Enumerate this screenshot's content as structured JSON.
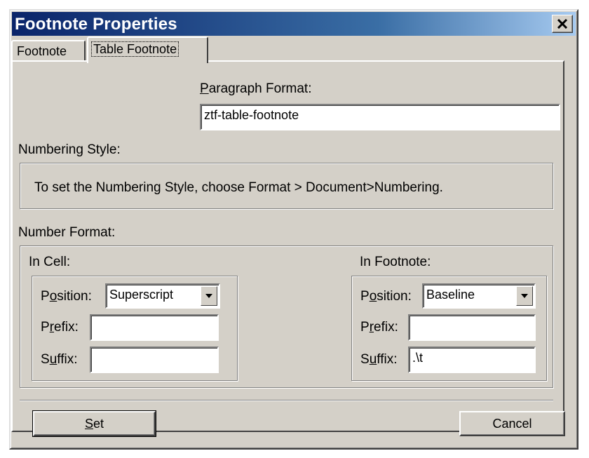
{
  "window": {
    "title": "Footnote Properties",
    "close_icon": "close-icon"
  },
  "tabs": [
    {
      "label": "Footnote",
      "active": false
    },
    {
      "label": "Table Footnote",
      "active": true
    }
  ],
  "paragraph_format": {
    "label_accel": "P",
    "label_rest": "aragraph Format:",
    "value": "ztf-table-footnote"
  },
  "numbering_style": {
    "label": "Numbering Style:",
    "message": "To set the Numbering Style, choose Format > Document>Numbering."
  },
  "number_format": {
    "label": "Number Format:",
    "in_cell": {
      "label": "In Cell:",
      "position_label_pre": "P",
      "position_label_accel": "o",
      "position_label_post": "sition:",
      "position_value": "Superscript",
      "prefix_label_pre": "P",
      "prefix_label_accel": "r",
      "prefix_label_post": "efix:",
      "prefix_value": "",
      "suffix_label_pre": "S",
      "suffix_label_accel": "u",
      "suffix_label_post": "ffix:",
      "suffix_value": ""
    },
    "in_footnote": {
      "label": "In Footnote:",
      "position_label_pre": "P",
      "position_label_accel": "o",
      "position_label_post": "sition:",
      "position_value": "Baseline",
      "prefix_label_pre": "P",
      "prefix_label_accel": "r",
      "prefix_label_post": "efix:",
      "prefix_value": "",
      "suffix_label_pre": "S",
      "suffix_label_accel": "u",
      "suffix_label_post": "ffix:",
      "suffix_value": ".\\t"
    }
  },
  "buttons": {
    "set_accel": "S",
    "set_rest": "et",
    "cancel": "Cancel"
  },
  "colors": {
    "title_gradient_start": "#0a246a",
    "title_gradient_end": "#a6caf0",
    "face": "#d4d0c8"
  }
}
